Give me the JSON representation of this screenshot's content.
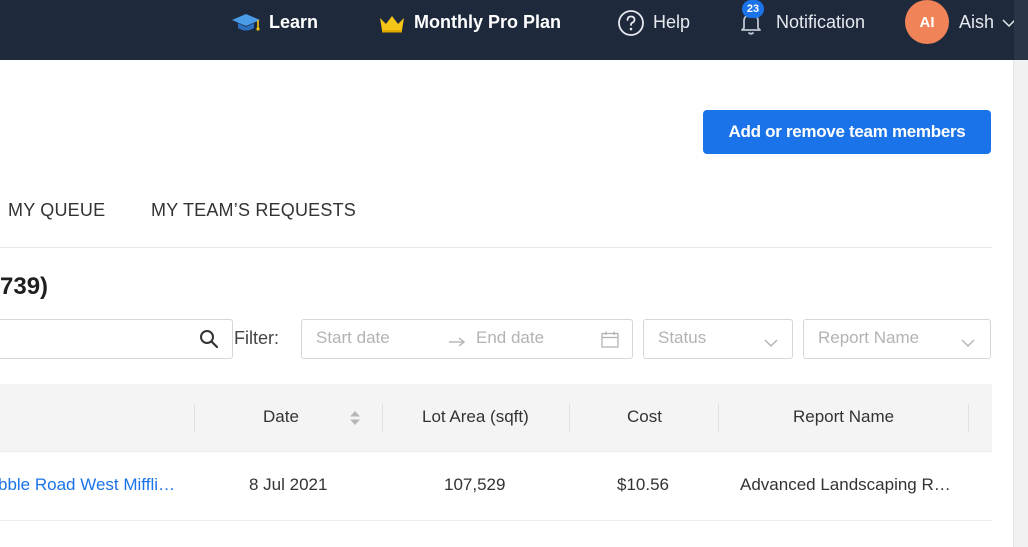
{
  "nav": {
    "learn_label": "Learn",
    "plan_label": "Monthly Pro Plan",
    "help_label": "Help",
    "notification_label": "Notification",
    "notification_count": "23",
    "avatar_initials": "AI",
    "user_name": "Aish"
  },
  "page": {
    "add_members_label": "Add or remove team members",
    "tabs": [
      "MY QUEUE",
      "MY TEAM’S REQUESTS"
    ],
    "heading_fragment": "739)"
  },
  "filters": {
    "label": "Filter:",
    "start_date_placeholder": "Start date",
    "end_date_placeholder": "End date",
    "status_placeholder": "Status",
    "report_name_placeholder": "Report Name"
  },
  "table": {
    "columns": [
      "Date",
      "Lot Area (sqft)",
      "Cost",
      "Report Name"
    ],
    "rows": [
      {
        "address": "bble Road West Miffli…",
        "date": "8 Jul 2021",
        "lot_area": "107,529",
        "cost": "$10.56",
        "report_name": "Advanced Landscaping R…"
      }
    ]
  },
  "colors": {
    "nav_bg": "#1e2a3c",
    "accent": "#1a73e8",
    "avatar_bg": "#f08358",
    "crown": "#f5c518"
  }
}
